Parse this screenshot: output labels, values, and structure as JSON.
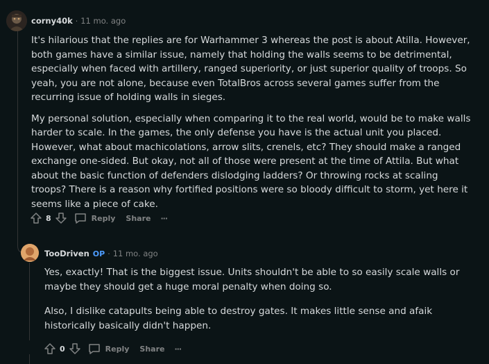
{
  "comments": [
    {
      "author": "corny40k",
      "separator": "·",
      "time": "11 mo. ago",
      "paragraphs": [
        "It's hilarious that the replies are for Warhammer 3 whereas the post is about Atilla. However, both games have a similar issue, namely that holding the walls seems to be detrimental, especially when faced with artillery, ranged superiority, or just superior quality of troops. So yeah, you are not alone, because even TotalBros across several games suffer from the recurring issue of holding walls in sieges.",
        "My personal solution, especially when comparing it to the real world, would be to make walls harder to scale. In the games, the only defense you have is the actual unit you placed. However, what about machicolations, arrow slits, crenels, etc? They should make a ranged exchange one-sided. But okay, not all of those were present at the time of Attila. But what about the basic function of defenders dislodging ladders? Or throwing rocks at scaling troops? There is a reason why fortified positions were so bloody difficult to storm, yet here it seems like a piece of cake."
      ],
      "score": "8",
      "reply_label": "Reply",
      "share_label": "Share",
      "more_label": "···"
    },
    {
      "author": "TooDriven",
      "op_badge": "OP",
      "separator": "·",
      "time": "11 mo. ago",
      "paragraphs": [
        "Yes, exactly! That is the biggest issue. Units shouldn't be able to so easily scale walls or maybe they should get a huge moral penalty when doing so.",
        "Also, I dislike catapults being able to destroy gates. It makes little sense and afaik historically basically didn't happen."
      ],
      "score": "0",
      "reply_label": "Reply",
      "share_label": "Share",
      "more_label": "···"
    }
  ]
}
